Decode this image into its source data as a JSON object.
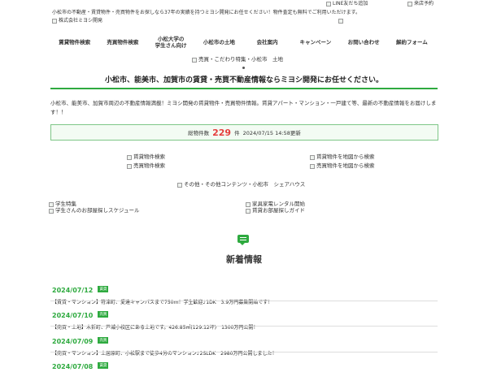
{
  "header": {
    "tagline": "小松市の不動産・賃貸物件・売買物件をお探しなら37年の実績を持つミヨシ開発にお任せください！物件査定も無料でご利用いただけます。",
    "logo_alt": "株式会社ミヨシ開発",
    "line_link": "LINE友だち追加",
    "visit_link": "来店予約"
  },
  "nav": {
    "items": [
      {
        "label": "賃貸物件検索"
      },
      {
        "label": "売買物件検索"
      },
      {
        "label": "小松大学の\n学生さん向け"
      },
      {
        "label": "小松市の土地"
      },
      {
        "label": "会社案内"
      },
      {
        "label": "キャンペーン"
      },
      {
        "label": "お問い合わせ"
      },
      {
        "label": "解約フォーム"
      }
    ]
  },
  "hero": {
    "image_alt": "売買・こだわり特集・小松市　土地",
    "headline": "小松市、能美市、加賀市の賃貸・売買不動産情報ならミヨシ開発にお任せください。",
    "description": "小松市、能美市、加賀市周辺の不動産情報満載！ミヨシ開発の賃貸物件・売買物件情報。賃貸アパート・マンション・一戸建て等、最新の不動産情報をお届けします！！"
  },
  "stats": {
    "label": "総物件数",
    "count": "229",
    "unit": "件",
    "updated": "2024/07/15 14:58更新"
  },
  "search_links": [
    "賃貸物件検索",
    "賃貸物件を地図から検索",
    "売買物件検索",
    "売買物件を地図から検索"
  ],
  "share_banner": "その他・その他コンテンツ・小松市　シェアハウス",
  "feature_links": [
    "学生特集",
    "家具家電レンタル開始",
    "学生さんのお部屋探しスケジュール",
    "賃貸お部屋探しガイド"
  ],
  "news": {
    "title": "新着情報",
    "items": [
      {
        "date": "2024/07/12",
        "badge": "賃貸",
        "text": "【賃貸・マンション】符津町、愛達キャンパスまで750ｍ！学生歓迎♪1DK　3.9万円募集開始です！"
      },
      {
        "date": "2024/07/10",
        "badge": "売買",
        "text": "【売買・土地】木折町、芦城小校区にある土地です。426.85㎡(129.12坪)　1300万円公開！"
      },
      {
        "date": "2024/07/09",
        "badge": "売買",
        "text": "【売買・マンション】土居原町、小松駅まで徒歩4分のマンション♪2SLDK　2980万円公開しました！"
      },
      {
        "date": "2024/07/08",
        "badge": "賃貸",
        "text": ""
      }
    ]
  },
  "colors": {
    "accent": "#2eaa3f",
    "count": "#e53e3e"
  }
}
